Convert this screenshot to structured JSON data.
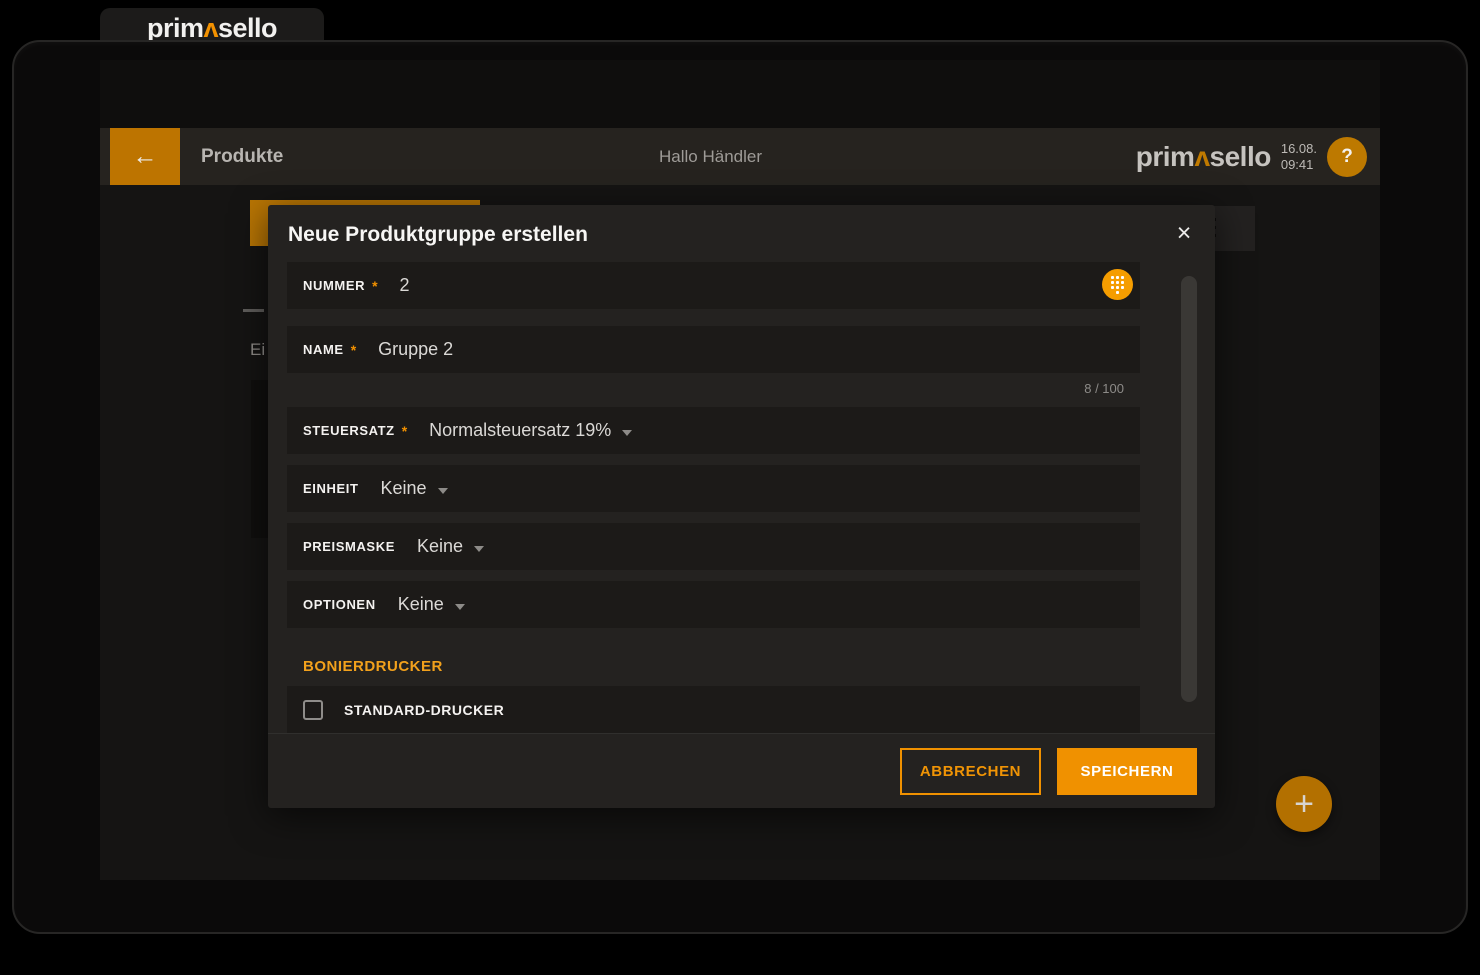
{
  "palette": {
    "accent": "#f29100",
    "accent_dimmed": "#bd7400",
    "modal_bg": "#242220",
    "field_bg": "#1c1a18",
    "page_bg": "#000000"
  },
  "browser_tab": {
    "logo": {
      "pre": "prim",
      "caret": "ʌ",
      "post": "sello"
    }
  },
  "header": {
    "back_icon": "←",
    "title": "Produkte",
    "greeting": "Hallo Händler",
    "logo": {
      "pre": "prim",
      "caret": "ʌ",
      "post": "sello"
    },
    "date": "16.08.",
    "time": "09:41",
    "help": "?"
  },
  "background_page": {
    "partial_text": "Ei"
  },
  "modal": {
    "title": "Neue Produktgruppe erstellen",
    "close": "×",
    "required_marker": "*",
    "fields": {
      "nummer": {
        "label": "NUMMER",
        "required": true,
        "value": "2"
      },
      "name": {
        "label": "NAME",
        "required": true,
        "value": "Gruppe 2",
        "counter": "8 / 100"
      },
      "steuersatz": {
        "label": "STEUERSATZ",
        "required": true,
        "value": "Normalsteuersatz 19%"
      },
      "einheit": {
        "label": "EINHEIT",
        "required": false,
        "value": "Keine"
      },
      "preismaske": {
        "label": "PREISMASKE",
        "required": false,
        "value": "Keine"
      },
      "optionen": {
        "label": "OPTIONEN",
        "required": false,
        "value": "Keine"
      }
    },
    "section": {
      "title": "BONIERDRUCKER"
    },
    "checkbox": {
      "label": "STANDARD-DRUCKER",
      "checked": false
    },
    "footer": {
      "cancel": "ABBRECHEN",
      "save": "SPEICHERN"
    }
  },
  "fab": {
    "plus": "+"
  }
}
